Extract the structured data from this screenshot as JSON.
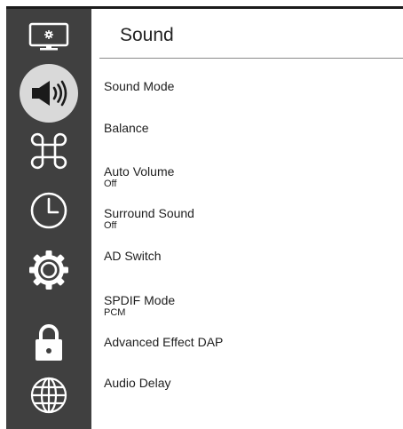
{
  "page": {
    "title": "Sound"
  },
  "sidebar": {
    "items": [
      {
        "icon": "display-settings-icon",
        "selected": false
      },
      {
        "icon": "speaker-icon",
        "selected": true
      },
      {
        "icon": "command-icon",
        "selected": false
      },
      {
        "icon": "clock-icon",
        "selected": false
      },
      {
        "icon": "gear-icon",
        "selected": false
      },
      {
        "icon": "lock-icon",
        "selected": false
      },
      {
        "icon": "globe-icon",
        "selected": false
      }
    ]
  },
  "menu": {
    "items": [
      {
        "label": "Sound Mode",
        "value": ""
      },
      {
        "label": "Balance",
        "value": ""
      },
      {
        "label": "Auto Volume",
        "value": "Off"
      },
      {
        "label": "Surround Sound",
        "value": "Off"
      },
      {
        "label": "AD Switch",
        "value": ""
      },
      {
        "label": "SPDIF Mode",
        "value": "PCM"
      },
      {
        "label": "Advanced Effect DAP",
        "value": ""
      },
      {
        "label": "Audio Delay",
        "value": ""
      }
    ]
  },
  "colors": {
    "sidebar_bg": "#404040",
    "selected_bg": "#d9d9d9",
    "icon": "#ffffff",
    "text": "#1e1e1e"
  }
}
